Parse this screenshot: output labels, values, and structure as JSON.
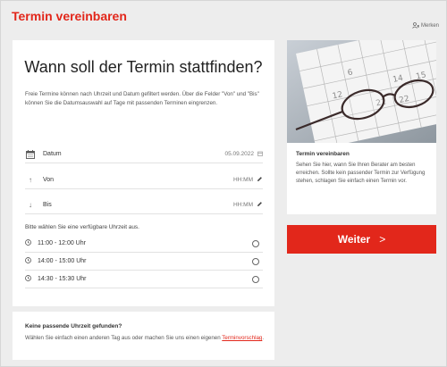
{
  "header": {
    "title": "Termin vereinbaren",
    "merken_label": "Merken"
  },
  "main": {
    "question": "Wann soll der Termin stattfinden?",
    "intro": "Freie Termine können nach Uhrzeit und Datum gefiltert werden. Über die Felder \"Von\" und \"Bis\" können Sie die Datumsauswahl auf Tage mit passenden Terminen eingrenzen.",
    "date_label": "Datum",
    "date_value": "05.09.2022",
    "von_label": "Von",
    "von_value": "HH:MM",
    "bis_label": "Bis",
    "bis_value": "HH:MM",
    "choose_text": "Bitte wählen Sie eine verfügbare Uhrzeit aus.",
    "slots": [
      {
        "label": "11:00 - 12:00 Uhr"
      },
      {
        "label": "14:00 - 15:00 Uhr"
      },
      {
        "label": "14:30 - 15:30 Uhr"
      }
    ]
  },
  "side": {
    "title": "Termin vereinbaren",
    "text": "Sehen Sie hier, wann Sie Ihren Berater am besten erreichen. Sollte kein passender Termin zur Verfügung stehen, schlagen Sie einfach einen Termin vor."
  },
  "weiter": {
    "label": "Weiter",
    "arrow": ">"
  },
  "help": {
    "title": "Keine passende Uhrzeit gefunden?",
    "text": "Wählen Sie einfach einen anderen Tag aus oder machen Sie uns einen eigenen",
    "link": "Terminvorschlag",
    "end": "."
  },
  "colors": {
    "accent": "#e2271b",
    "background": "#ededed"
  }
}
